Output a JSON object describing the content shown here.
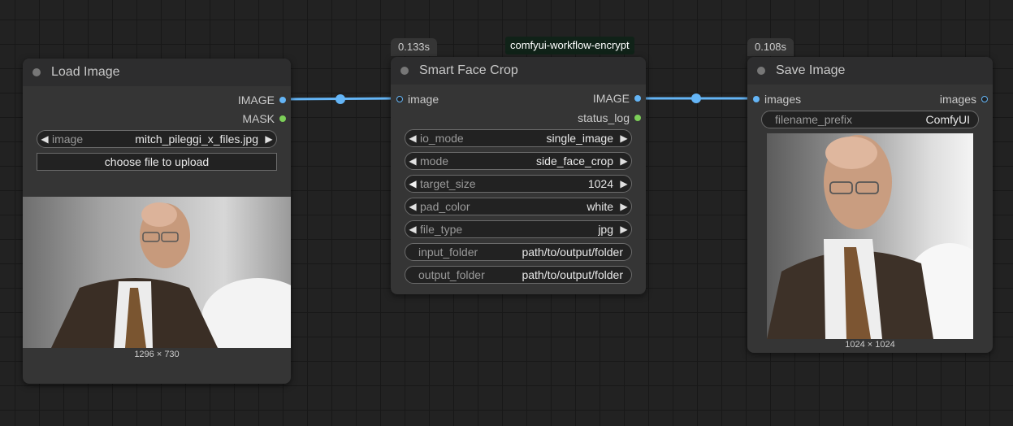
{
  "colors": {
    "canvas": "#222222",
    "node_bg": "#353535",
    "image_link": "#64b5f6",
    "string_link": "#7ccf58"
  },
  "group_tag": "comfyui-workflow-encrypt",
  "load_image": {
    "title": "Load Image",
    "outputs": [
      "IMAGE",
      "MASK"
    ],
    "image_widget": {
      "label": "image",
      "value": "mitch_pileggi_x_files.jpg"
    },
    "upload_button": "choose file to upload",
    "image_size": "1296 × 730"
  },
  "smart_face_crop": {
    "title": "Smart Face Crop",
    "time": "0.133s",
    "input": "image",
    "outputs": [
      "IMAGE",
      "status_log"
    ],
    "widgets": [
      {
        "label": "io_mode",
        "value": "single_image"
      },
      {
        "label": "mode",
        "value": "side_face_crop"
      },
      {
        "label": "target_size",
        "value": "1024"
      },
      {
        "label": "pad_color",
        "value": "white"
      },
      {
        "label": "file_type",
        "value": "jpg"
      }
    ],
    "text_widgets": [
      {
        "label": "input_folder",
        "value": "path/to/output/folder"
      },
      {
        "label": "output_folder",
        "value": "path/to/output/folder"
      }
    ]
  },
  "save_image": {
    "title": "Save Image",
    "time": "0.108s",
    "input": "images",
    "output": "images",
    "prefix_widget": {
      "label": "filename_prefix",
      "value": "ComfyUI"
    },
    "image_size": "1024 × 1024"
  }
}
